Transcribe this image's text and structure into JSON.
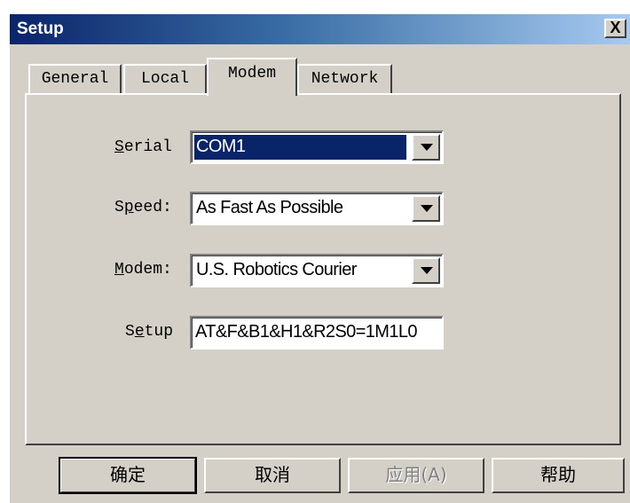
{
  "window": {
    "title": "Setup",
    "close_label": "X"
  },
  "tabs": [
    {
      "label": "General",
      "active": false
    },
    {
      "label": "Local",
      "active": false
    },
    {
      "label": "Modem",
      "active": true
    },
    {
      "label": "Network",
      "active": false
    }
  ],
  "form": {
    "serial": {
      "label_pre": "",
      "label_ul": "S",
      "label_post": "erial",
      "value": "COM1"
    },
    "speed": {
      "label_pre": "S",
      "label_ul": "p",
      "label_post": "eed:",
      "value": "As Fast As Possible"
    },
    "modem": {
      "label_pre": "",
      "label_ul": "M",
      "label_post": "odem:",
      "value": "U.S. Robotics Courier"
    },
    "setup": {
      "label_pre": "S",
      "label_ul": "e",
      "label_post": "tup",
      "value": "AT&F&B1&H1&R2S0=1M1L0"
    }
  },
  "buttons": {
    "ok": "确定",
    "cancel": "取消",
    "apply": "应用(A)",
    "help": "帮助"
  },
  "colors": {
    "title_gradient_start": "#0a246a",
    "title_gradient_end": "#a6caf0",
    "face": "#d4d0c8",
    "selection": "#0a246a"
  },
  "icons": {
    "dropdown": "chevron-down-icon",
    "close": "close-icon"
  }
}
